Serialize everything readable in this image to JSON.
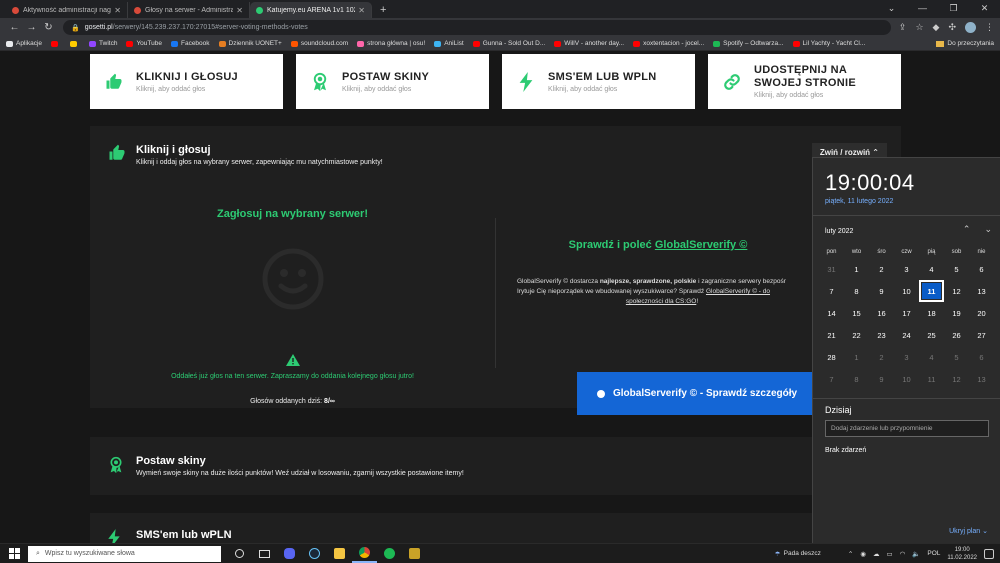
{
  "browser": {
    "tabs": [
      {
        "title": "Aktywność administracji nagrodz...",
        "color": "#d84a3a",
        "active": false
      },
      {
        "title": "Głosy na serwer - Administracja",
        "color": "#d84a3a",
        "active": false
      },
      {
        "title": "Katujemy.eu ARENA 1v1 102TR",
        "color": "#2dcb73",
        "active": true
      }
    ],
    "url_host": "gosetti.pl",
    "url_path": "/serwery/145.239.237.170:27015#server-voting-methods-votes",
    "bookmarks": [
      {
        "label": "Aplikacje",
        "color": "#e8eaed"
      },
      {
        "label": "",
        "color": "#ff0000"
      },
      {
        "label": "",
        "color": "#ffcc00"
      },
      {
        "label": "Twitch",
        "color": "#9146ff"
      },
      {
        "label": "YouTube",
        "color": "#ff0000"
      },
      {
        "label": "Facebook",
        "color": "#1877f2"
      },
      {
        "label": "Dziennik UONET+",
        "color": "#e67e22"
      },
      {
        "label": "soundcloud.com",
        "color": "#ff5500"
      },
      {
        "label": "strona główna | osu!",
        "color": "#ff66aa"
      },
      {
        "label": "AniList",
        "color": "#3db4f2"
      },
      {
        "label": "Gunna - Sold Out D...",
        "color": "#ff0000"
      },
      {
        "label": "WillV - another day...",
        "color": "#ff0000"
      },
      {
        "label": "xoxtentacion - jocel...",
        "color": "#ff0000"
      },
      {
        "label": "Spotify – Odtwarza...",
        "color": "#1db954"
      },
      {
        "label": "Lil Yachty - Yacht Cl...",
        "color": "#ff0000"
      }
    ],
    "other_bookmarks": "Do przeczytania"
  },
  "methods": [
    {
      "title": "KLIKNIJ I GŁOSUJ",
      "sub": "Kliknij, aby oddać głos",
      "icon": "thumbs-up-icon"
    },
    {
      "title": "POSTAW SKINY",
      "sub": "Kliknij, aby oddać głos",
      "icon": "award-icon"
    },
    {
      "title": "SMS'EM LUB WPLN",
      "sub": "Kliknij, aby oddać głos",
      "icon": "lightning-icon"
    },
    {
      "title1": "UDOSTĘPNIJ NA",
      "title2": "SWOJEJ STRONIE",
      "sub": "Kliknij, aby oddać głos",
      "icon": "link-icon"
    }
  ],
  "main_section": {
    "title": "Kliknij i głosuj",
    "desc": "Kliknij i oddaj głos na wybrany serwer, zapewniając mu natychmiastowe punkty!",
    "toggle": "Zwiń / rozwiń",
    "vote_title": "Zagłosuj na wybrany serwer!",
    "voted_msg": "Oddałeś już głos na ten serwer. Zapraszamy do oddania kolejnego głosu jutro!",
    "count_label": "Głosów oddanych dziś:",
    "count_value": "8/∞",
    "gs_title_pre": "Sprawdź i poleć",
    "gs_title_link": "GlobalServerify ©",
    "gs_line1_a": "GlobalServerify © dostarcza ",
    "gs_line1_b": "najlepsze, sprawdzone, polskie",
    "gs_line1_c": " i zagraniczne serwery bezpośr",
    "gs_line2_a": "Irytuje Cię nieporządek we wbudowanej wyszukiwarce? Sprawdź ",
    "gs_line2_b": "GlobalServerify © - do",
    "gs_line3": "społeczności dla CS:GO",
    "gs_line3_end": "!",
    "gs_button": "GlobalServerify © - Sprawdź szczegóły"
  },
  "skins_section": {
    "title": "Postaw skiny",
    "desc": "Wymień swoje skiny na duże ilości punktów! Weź udział w losowaniu, zgarnij wszystkie postawione itemy!"
  },
  "sms_section": {
    "title": "SMS'em lub wPLN"
  },
  "calendar": {
    "time": "19:00:04",
    "date": "piątek, 11 lutego 2022",
    "month": "luty 2022",
    "weekdays": [
      "pon",
      "wto",
      "śro",
      "czw",
      "pią",
      "sob",
      "nie"
    ],
    "days": [
      [
        "31",
        "dim"
      ],
      [
        "1",
        ""
      ],
      [
        "2",
        ""
      ],
      [
        "3",
        ""
      ],
      [
        "4",
        ""
      ],
      [
        "5",
        ""
      ],
      [
        "6",
        ""
      ],
      [
        "7",
        ""
      ],
      [
        "8",
        ""
      ],
      [
        "9",
        ""
      ],
      [
        "10",
        ""
      ],
      [
        "11",
        "today"
      ],
      [
        "12",
        ""
      ],
      [
        "13",
        ""
      ],
      [
        "14",
        ""
      ],
      [
        "15",
        ""
      ],
      [
        "16",
        ""
      ],
      [
        "17",
        ""
      ],
      [
        "18",
        ""
      ],
      [
        "19",
        ""
      ],
      [
        "20",
        ""
      ],
      [
        "21",
        ""
      ],
      [
        "22",
        ""
      ],
      [
        "23",
        ""
      ],
      [
        "24",
        ""
      ],
      [
        "25",
        ""
      ],
      [
        "26",
        ""
      ],
      [
        "27",
        ""
      ],
      [
        "28",
        ""
      ],
      [
        "1",
        "dim"
      ],
      [
        "2",
        "dim"
      ],
      [
        "3",
        "dim"
      ],
      [
        "4",
        "dim"
      ],
      [
        "5",
        "dim"
      ],
      [
        "6",
        "dim"
      ],
      [
        "7",
        "dim"
      ],
      [
        "8",
        "dim"
      ],
      [
        "9",
        "dim"
      ],
      [
        "10",
        "dim"
      ],
      [
        "11",
        "dim"
      ],
      [
        "12",
        "dim"
      ],
      [
        "13",
        "dim"
      ]
    ],
    "today_label": "Dzisiaj",
    "input_placeholder": "Dodaj zdarzenie lub przypomnienie",
    "no_events": "Brak zdarzeń",
    "hide_plan": "Ukryj plan"
  },
  "taskbar": {
    "search_placeholder": "Wpisz tu wyszukiwane słowa",
    "weather": "Pada deszcz",
    "lang": "POL",
    "time": "19:00",
    "date": "11.02.2022"
  }
}
